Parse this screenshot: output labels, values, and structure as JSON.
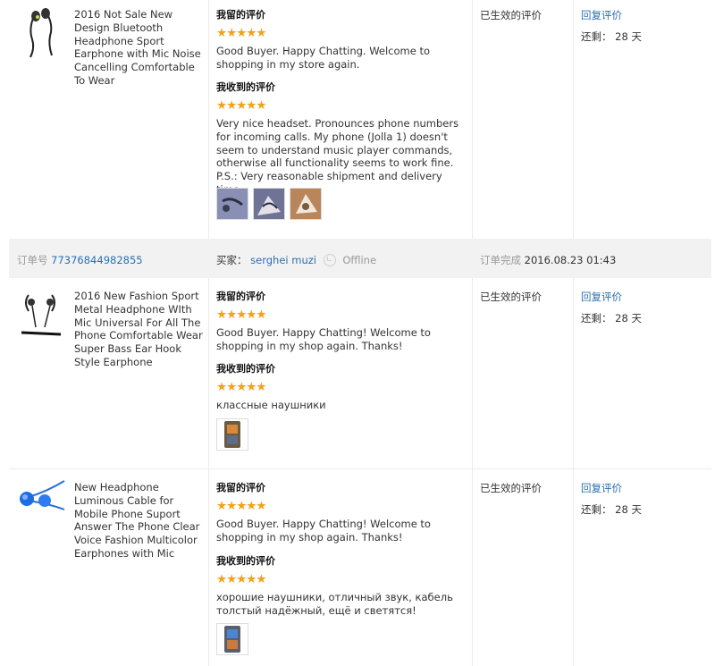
{
  "top_products": [
    {
      "title": "2016 Not Sale New Design Bluetooth Headphone Sport Earphone with Mic Noise Cancelling Comfortable To Wear",
      "my_review_heading": "我留的评价",
      "my_stars": "★★★★★",
      "my_review": "Good Buyer. Happy Chatting. Welcome to shopping in my store again.",
      "received_heading": "我收到的评价",
      "received_stars": "★★★★★",
      "received_review": "Very nice headset. Pronounces phone numbers for incoming calls. My phone (Jolla 1) doesn't seem to understand music player commands, otherwise all functionality seems to work fine. P.S.: Very reasonable shipment and delivery time.",
      "status": "已生效的评价",
      "reply": "回复评价",
      "remain": "还剩： 28 天"
    }
  ],
  "order": {
    "number_label": "订单号",
    "number": "77376844982855",
    "buyer_label": "买家：",
    "buyer": "serghei muzi",
    "online_status": "Offline",
    "completed_label": "订单完成",
    "completed_time": "2016.08.23 01:43"
  },
  "products": [
    {
      "title": "2016 New Fashion Sport Metal Headphone WIth Mic Universal For All The Phone Comfortable Wear Super Bass Ear Hook Style Earphone",
      "my_review_heading": "我留的评价",
      "my_stars": "★★★★★",
      "my_review": "Good Buyer. Happy Chatting! Welcome to shopping in my shop again. Thanks!",
      "received_heading": "我收到的评价",
      "received_stars": "★★★★★",
      "received_review": "классные наушники",
      "status": "已生效的评价",
      "reply": "回复评价",
      "remain": "还剩： 28 天"
    },
    {
      "title": "New Headphone Luminous Cable for Mobile Phone Suport Answer The Phone Clear Voice Fashion Multicolor Earphones with Mic",
      "my_review_heading": "我留的评价",
      "my_stars": "★★★★★",
      "my_review": "Good Buyer. Happy Chatting! Welcome to shopping in my shop again. Thanks!",
      "received_heading": "我收到的评价",
      "received_stars": "★★★★★",
      "received_review": "хорошие наушники, отличный звук, кабель толстый надёжный, ещё и светятся!",
      "status": "已生效的评价",
      "reply": "回复评价",
      "remain": "还剩： 28 天"
    }
  ],
  "colors": {
    "link": "#2a6fb0",
    "star": "#f2a21b",
    "header_bg": "#f2f2f2",
    "divider": "#ececec"
  }
}
